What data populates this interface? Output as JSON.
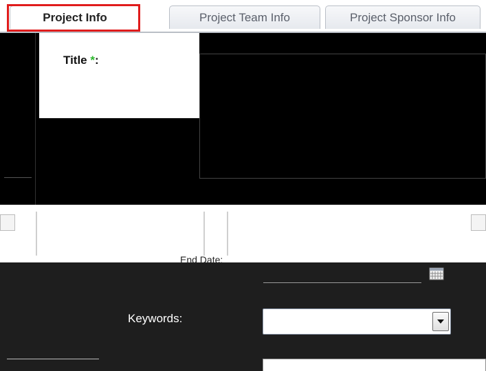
{
  "tabs": [
    {
      "label": "Project Info",
      "active": true
    },
    {
      "label": "Project Team Info",
      "active": false
    },
    {
      "label": "Project Sponsor Info",
      "active": false
    }
  ],
  "form": {
    "title_label": "Title",
    "required_marker": "*",
    "title_colon": ":",
    "title_value": "",
    "end_date_label": "End Date:",
    "end_date_value": "",
    "keywords_label": "Keywords:",
    "keywords_value": ""
  },
  "icons": {
    "calendar": "calendar-icon",
    "dropdown": "chevron-down-icon"
  },
  "colors": {
    "highlight": "#e01b1b",
    "required": "#2db82d"
  }
}
